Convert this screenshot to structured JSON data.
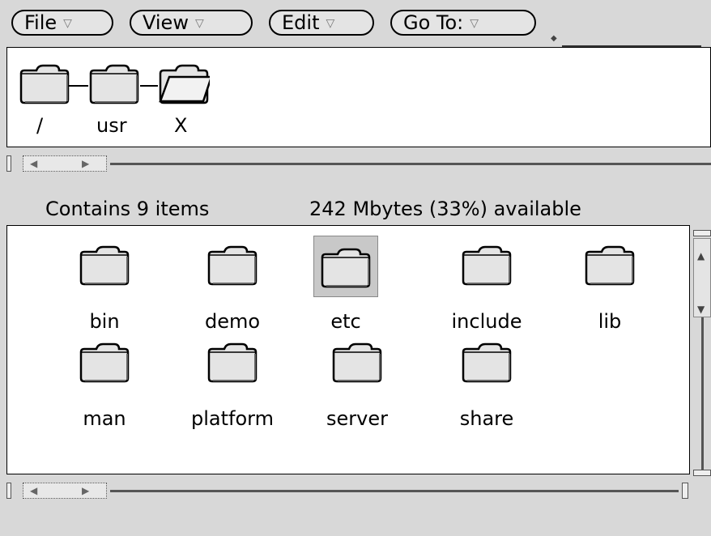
{
  "menubar": {
    "file_label": "File",
    "view_label": "View",
    "edit_label": "Edit",
    "goto_label": "Go To:",
    "dropdown_icon": "triangle-down-icon"
  },
  "path": {
    "items": [
      {
        "label": "/",
        "state": "closed"
      },
      {
        "label": "usr",
        "state": "closed"
      },
      {
        "label": "X",
        "state": "open"
      }
    ]
  },
  "status": {
    "items_text": "Contains 9 items",
    "space_text": "242 Mbytes (33%) available"
  },
  "contents": {
    "items": [
      {
        "label": "bin",
        "selected": false
      },
      {
        "label": "demo",
        "selected": false
      },
      {
        "label": "etc",
        "selected": true
      },
      {
        "label": "include",
        "selected": false
      },
      {
        "label": "lib",
        "selected": false
      },
      {
        "label": "man",
        "selected": false
      },
      {
        "label": "platform",
        "selected": false
      },
      {
        "label": "server",
        "selected": false
      },
      {
        "label": "share",
        "selected": false
      }
    ]
  },
  "colors": {
    "background": "#d8d8d8",
    "pane": "#ffffff",
    "selection": "#c8c8c8"
  }
}
